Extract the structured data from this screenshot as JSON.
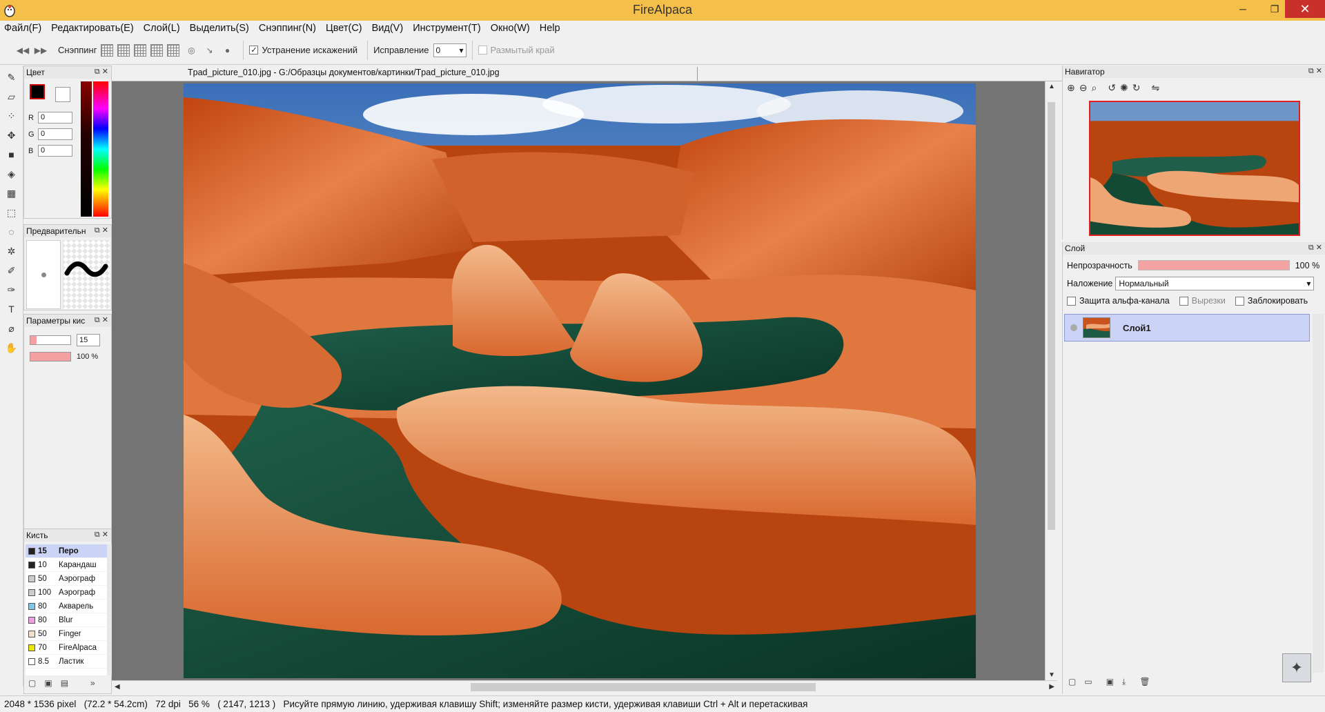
{
  "window": {
    "title": "FireAlpaca",
    "minimize": "─",
    "maximize": "❐",
    "close": "✕"
  },
  "menu": [
    "Файл(F)",
    "Редактировать(E)",
    "Слой(L)",
    "Выделить(S)",
    "Снэппинг(N)",
    "Цвет(C)",
    "Вид(V)",
    "Инструмент(T)",
    "Окно(W)",
    "Help"
  ],
  "toolbar": {
    "snapping_label": "Снэппинг",
    "distortion_checked": true,
    "distortion_label": "Устранение искажений",
    "correction_label": "Исправление",
    "correction_value": "0",
    "blur_edge_checked": false,
    "blur_edge_label": "Размытый край"
  },
  "panels": {
    "color": {
      "title": "Цвет",
      "r_label": "R",
      "r_value": "0",
      "g_label": "G",
      "g_value": "0",
      "b_label": "B",
      "b_value": "0",
      "fg_color": "#000000",
      "bg_color": "#ffffff"
    },
    "preview": {
      "title": "Предварительн"
    },
    "brush_params": {
      "title": "Параметры кис",
      "size_value": "15",
      "size_fraction": 0.15,
      "opacity_value": "100 %",
      "opacity_fraction": 1.0
    },
    "brush": {
      "title": "Кисть",
      "items": [
        {
          "size": "15",
          "name": "Перо",
          "color": "#222222",
          "selected": true
        },
        {
          "size": "10",
          "name": "Карандаш",
          "color": "#222222",
          "selected": false
        },
        {
          "size": "50",
          "name": "Аэрограф",
          "color": "#cccccc",
          "selected": false
        },
        {
          "size": "100",
          "name": "Аэрограф",
          "color": "#cccccc",
          "selected": false
        },
        {
          "size": "80",
          "name": "Акварель",
          "color": "#7ec8e8",
          "selected": false
        },
        {
          "size": "80",
          "name": "Blur",
          "color": "#f0a0e0",
          "selected": false
        },
        {
          "size": "50",
          "name": "Finger",
          "color": "#f4e0c8",
          "selected": false
        },
        {
          "size": "70",
          "name": "FireAlpaca",
          "color": "#e8e800",
          "selected": false
        },
        {
          "size": "8.5",
          "name": "Ластик",
          "color": "#ffffff",
          "selected": false
        }
      ]
    },
    "navigator": {
      "title": "Навигатор"
    },
    "layer": {
      "title": "Слой",
      "opacity_label": "Непрозрачность",
      "opacity_value": "100 %",
      "opacity_fraction": 1.0,
      "blend_label": "Наложение",
      "blend_value": "Нормальный",
      "alpha_lock_label": "Защита альфа-канала",
      "clipping_label": "Вырезки",
      "lock_label": "Заблокировать",
      "layers": [
        {
          "name": "Слой1"
        }
      ]
    }
  },
  "document": {
    "tab_title": "Tpad_picture_010.jpg - G:/Образцы документов/картинки/Tpad_picture_010.jpg"
  },
  "status": {
    "text": "2048 * 1536 pixel   (72.2 * 54.2cm)   72 dpi   56 %   ( 2147, 1213 )   Рисуйте прямую линию, удерживая клавишу Shift; изменяйте размер кисти, удерживая клавиши Ctrl + Alt и перетаскивая"
  },
  "colors": {
    "title_bar": "#f5c04a",
    "close_button": "#c9302c",
    "selection": "#cbd3f7",
    "opacity_bar": "#f4a3a3",
    "nav_frame": "#e02020",
    "canvas_bg": "#747474"
  }
}
